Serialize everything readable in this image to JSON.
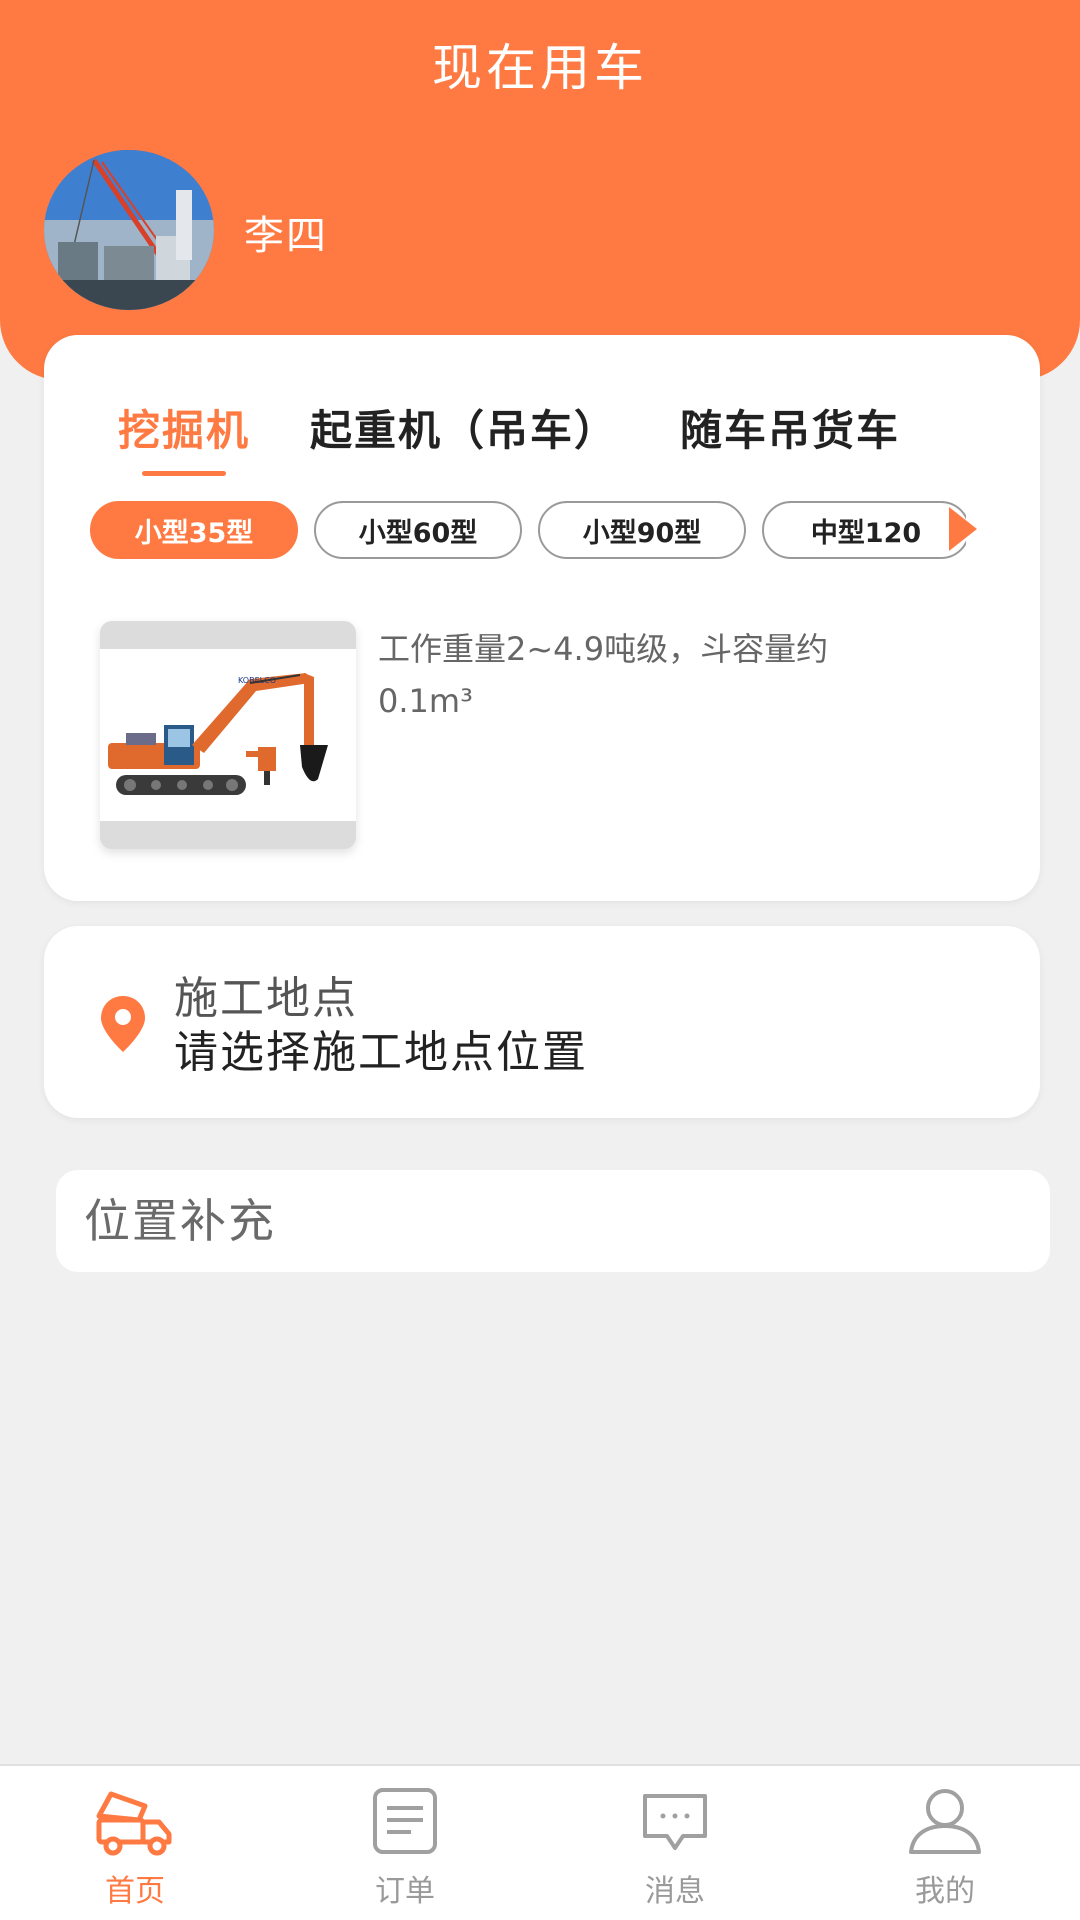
{
  "header": {
    "title": "现在用车",
    "user_name": "李四",
    "accent_color": "#ff7a42"
  },
  "category_tabs": [
    {
      "label": "挖掘机",
      "active": true
    },
    {
      "label": "起重机（吊车）",
      "active": false
    },
    {
      "label": "随车吊货车",
      "active": false
    }
  ],
  "size_chips": [
    {
      "label": "小型35型",
      "active": true
    },
    {
      "label": "小型60型",
      "active": false
    },
    {
      "label": "小型90型",
      "active": false
    },
    {
      "label": "中型120",
      "active": false
    }
  ],
  "machine": {
    "image": "excavator-image",
    "description_line1": "工作重量2~4.9吨级，斗容量约",
    "description_line2": "0.1m³"
  },
  "location": {
    "title": "施工地点",
    "value": "请选择施工地点位置",
    "icon": "location-pin-icon"
  },
  "extra": {
    "placeholder": "位置补充"
  },
  "bottom_nav": [
    {
      "label": "首页",
      "icon": "dump-truck-icon",
      "active": true
    },
    {
      "label": "订单",
      "icon": "document-icon",
      "active": false
    },
    {
      "label": "消息",
      "icon": "chat-bubble-icon",
      "active": false
    },
    {
      "label": "我的",
      "icon": "user-icon",
      "active": false
    }
  ]
}
